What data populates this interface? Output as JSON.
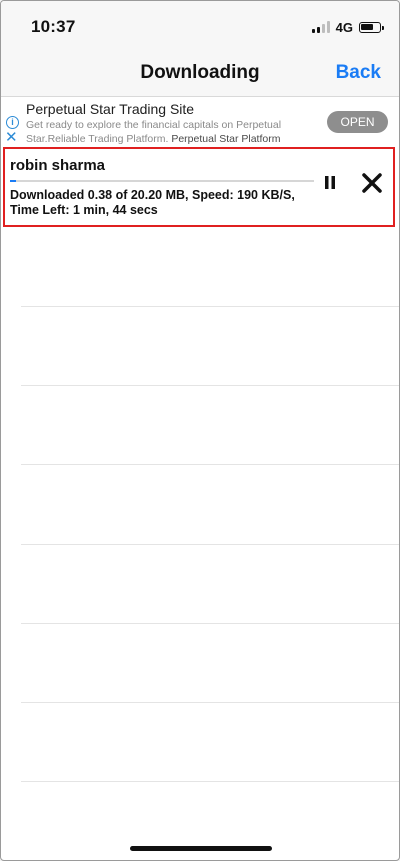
{
  "status_bar": {
    "time": "10:37",
    "network": "4G",
    "signal_bars_total": 4,
    "signal_bars_active": 2,
    "battery_level": 0.7
  },
  "nav": {
    "title": "Downloading",
    "back_label": "Back",
    "back_color": "#1a7cf5"
  },
  "ad": {
    "title": "Perpetual Star Trading Site",
    "description": "Get ready to explore the financial capitals on Perpetual Star.Reliable Trading Platform.",
    "brand": "Perpetual Star Platform",
    "open_label": "OPEN",
    "info_icon": "info-icon",
    "close_icon": "close-icon"
  },
  "download": {
    "name": "robin sharma",
    "status_line1": "Downloaded 0.38 of 20.20 MB, Speed: 190 KB/S,",
    "status_line2": "Time Left: 1 min, 44 secs",
    "progress": 0.019,
    "pause_icon": "pause-icon",
    "cancel_icon": "cancel-icon",
    "highlight_color": "#e02020"
  }
}
